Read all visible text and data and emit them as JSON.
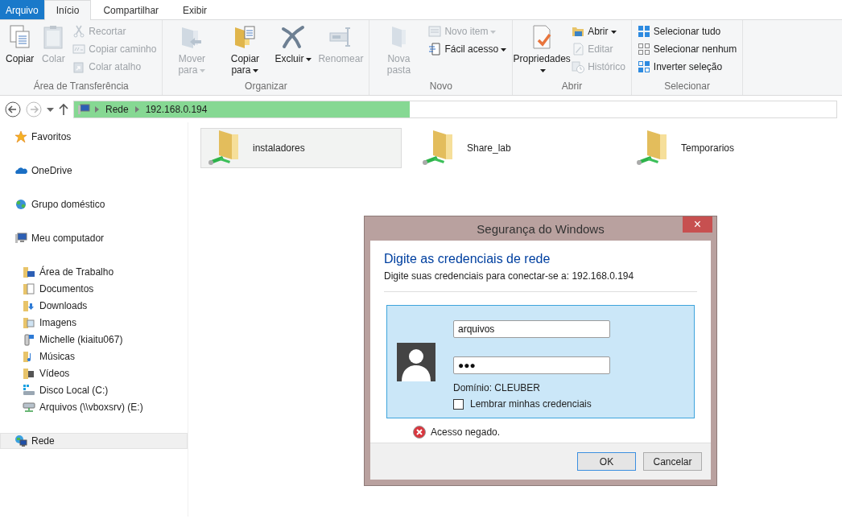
{
  "ribbon": {
    "tabs": [
      {
        "label": "Arquivo",
        "kind": "file",
        "selected": false
      },
      {
        "label": "Início",
        "kind": "tab",
        "selected": true
      },
      {
        "label": "Compartilhar",
        "kind": "tab",
        "selected": false
      },
      {
        "label": "Exibir",
        "kind": "tab",
        "selected": false
      }
    ],
    "groups": [
      {
        "label": "Área de Transferência",
        "items": [
          {
            "kind": "large",
            "label": "Copiar",
            "disabled": false,
            "caret": false
          },
          {
            "kind": "large",
            "label": "Colar",
            "disabled": true,
            "caret": false
          },
          {
            "kind": "small",
            "label": "Recortar",
            "disabled": true,
            "caret": false
          },
          {
            "kind": "small",
            "label": "Copiar caminho",
            "disabled": true,
            "caret": false
          },
          {
            "kind": "small",
            "label": "Colar atalho",
            "disabled": true,
            "caret": false
          }
        ]
      },
      {
        "label": "Organizar",
        "items": [
          {
            "kind": "large",
            "label": "Mover para",
            "disabled": true,
            "caret": true
          },
          {
            "kind": "large",
            "label": "Copiar para",
            "disabled": false,
            "caret": true
          },
          {
            "kind": "large",
            "label": "Excluir",
            "disabled": false,
            "caret": true
          },
          {
            "kind": "large",
            "label": "Renomear",
            "disabled": true,
            "caret": false
          }
        ]
      },
      {
        "label": "Novo",
        "items": [
          {
            "kind": "large",
            "label": "Nova pasta",
            "disabled": true,
            "caret": false
          },
          {
            "kind": "small",
            "label": "Novo item",
            "disabled": true,
            "caret": true
          },
          {
            "kind": "small",
            "label": "Fácil acesso",
            "disabled": false,
            "caret": true
          }
        ]
      },
      {
        "label": "Abrir",
        "items": [
          {
            "kind": "large",
            "label": "Propriedades",
            "disabled": false,
            "caret": true
          },
          {
            "kind": "small",
            "label": "Abrir",
            "disabled": false,
            "caret": true
          },
          {
            "kind": "small",
            "label": "Editar",
            "disabled": true,
            "caret": false
          },
          {
            "kind": "small",
            "label": "Histórico",
            "disabled": true,
            "caret": false
          }
        ]
      },
      {
        "label": "Selecionar",
        "items": [
          {
            "kind": "small",
            "label": "Selecionar tudo",
            "disabled": false,
            "caret": false
          },
          {
            "kind": "small",
            "label": "Selecionar nenhum",
            "disabled": false,
            "caret": false
          },
          {
            "kind": "small",
            "label": "Inverter seleção",
            "disabled": false,
            "caret": false
          }
        ]
      }
    ]
  },
  "address": {
    "segments": [
      "Rede",
      "192.168.0.194"
    ],
    "level": 0.44
  },
  "sidebar": {
    "items": [
      {
        "label": "Favoritos",
        "selected": false
      },
      {
        "label": "OneDrive",
        "selected": false
      },
      {
        "label": "Grupo doméstico",
        "selected": false
      },
      {
        "label": "Meu computador",
        "selected": false,
        "children": [
          {
            "label": "Área de Trabalho",
            "selected": false
          },
          {
            "label": "Documentos",
            "selected": false
          },
          {
            "label": "Downloads",
            "selected": false
          },
          {
            "label": "Imagens",
            "selected": false
          },
          {
            "label": "Michelle (kiaitu067)",
            "selected": false
          },
          {
            "label": "Músicas",
            "selected": false
          },
          {
            "label": "Vídeos",
            "selected": false
          },
          {
            "label": "Disco Local (C:)",
            "selected": false
          },
          {
            "label": "Arquivos (\\\\vboxsrv) (E:)",
            "selected": false
          }
        ]
      },
      {
        "label": "Rede",
        "selected": true
      }
    ]
  },
  "folders": [
    {
      "name": "instaladores",
      "selected": true
    },
    {
      "name": "Share_lab",
      "selected": false
    },
    {
      "name": "Temporarios",
      "selected": false
    }
  ],
  "dialog": {
    "title": "Segurança do Windows",
    "close": "×",
    "heading": "Digite as credenciais de rede",
    "subtitle": "Digite suas credenciais para conectar-se a: 192.168.0.194",
    "username": "arquivos",
    "password": "●●●",
    "domain": "Domínio: CLEUBER",
    "remember": {
      "label": "Lembrar minhas credenciais",
      "checked": false
    },
    "error": "Acesso negado.",
    "buttons": [
      {
        "label": "OK",
        "default": true
      },
      {
        "label": "Cancelar",
        "default": false
      }
    ]
  }
}
